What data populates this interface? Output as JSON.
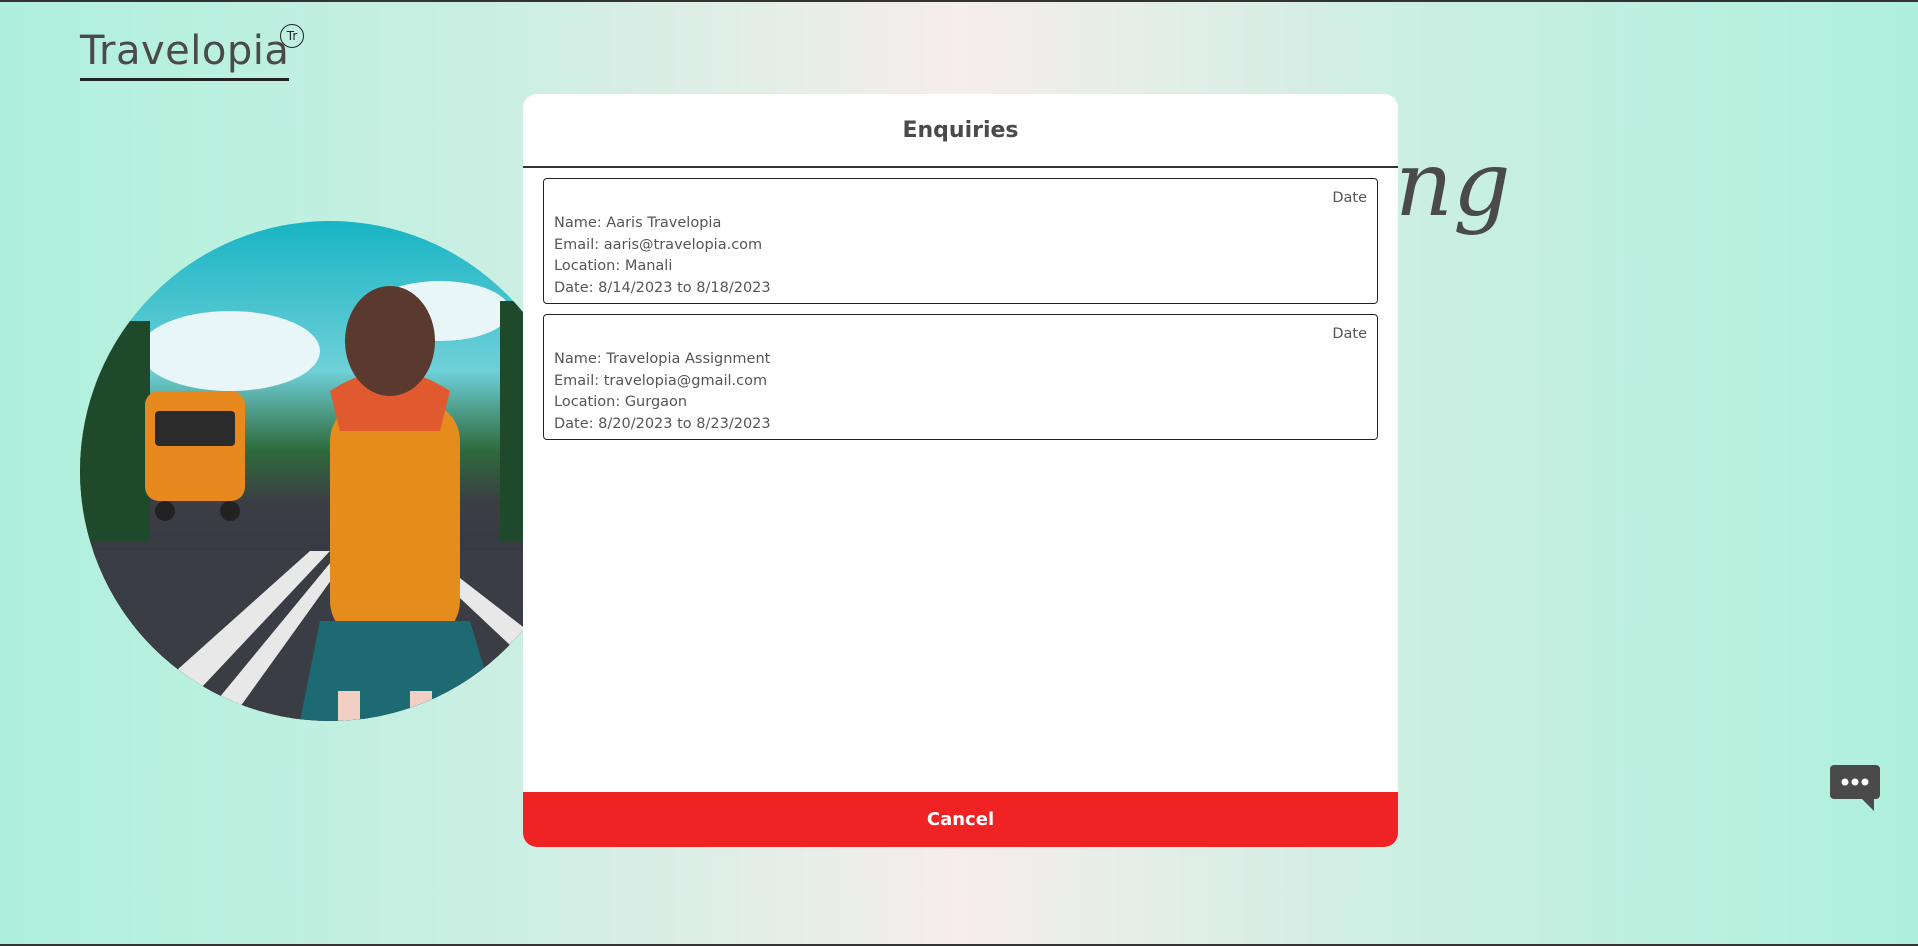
{
  "header": {
    "logo": "Travelopia",
    "logo_mark": "Tr"
  },
  "hero": {
    "script_text": "ng"
  },
  "modal": {
    "title": "Enquiries",
    "enquiries": [
      {
        "date_label": "Date",
        "name": "Name: Aaris Travelopia",
        "email": "Email: aaris@travelopia.com",
        "location": "Location: Manali",
        "date": "Date: 8/14/2023 to 8/18/2023"
      },
      {
        "date_label": "Date",
        "name": "Name: Travelopia Assignment",
        "email": "Email: travelopia@gmail.com",
        "location": "Location: Gurgaon",
        "date": "Date: 8/20/2023 to 8/23/2023"
      }
    ],
    "cancel_label": "Cancel"
  },
  "icons": {
    "chat": "chat-bubble-icon"
  },
  "colors": {
    "cancel": "#ef2323",
    "text": "#4a4a4a"
  }
}
